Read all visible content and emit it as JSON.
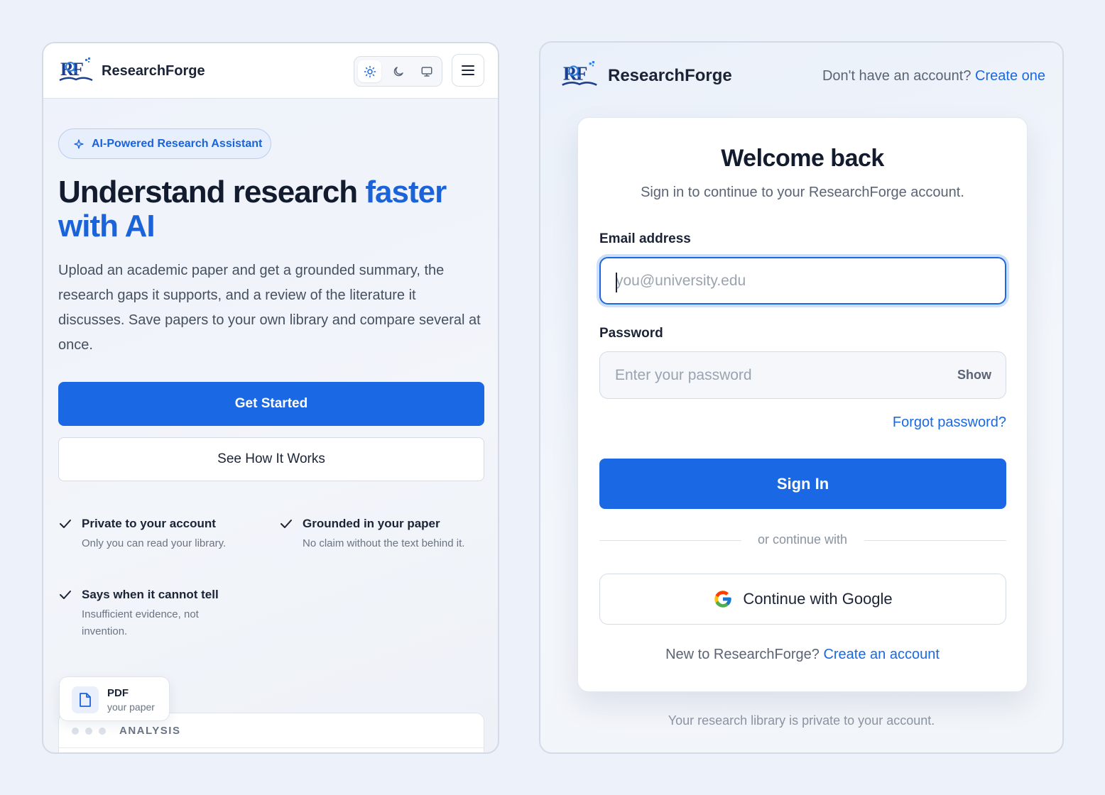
{
  "left_panel": {
    "header": {
      "brand": "ResearchForge",
      "theme_options": [
        "light-icon",
        "dark-icon",
        "system-icon"
      ],
      "active_theme": "light"
    },
    "badge": "AI-Powered Research Assistant",
    "hero": {
      "title_part1": "Understand research ",
      "title_accent": "faster with AI",
      "description": "Upload an academic paper and get a grounded summary, the research gaps it supports, and a review of the literature it discusses. Save papers to your own library and compare several at once."
    },
    "buttons": {
      "primary": "Get Started",
      "secondary": "See How It Works"
    },
    "features": [
      {
        "title": "Private to your account",
        "desc": "Only you can read your library."
      },
      {
        "title": "Grounded in your paper",
        "desc": "No claim without the text behind it."
      },
      {
        "title": "Says when it cannot tell",
        "desc": "Insufficient evidence, not invention."
      }
    ],
    "pdf_card": {
      "title": "PDF",
      "subtitle": "your paper"
    },
    "analysis_card": {
      "label": "ANALYSIS"
    }
  },
  "right_panel": {
    "brand": "ResearchForge",
    "signup_prompt": "Don't have an account?",
    "signup_link": "Create one",
    "card": {
      "title": "Welcome back",
      "subtitle": "Sign in to continue to your ResearchForge account.",
      "email_label": "Email address",
      "email_placeholder": "you@university.edu",
      "password_label": "Password",
      "password_placeholder": "Enter your password",
      "show_label": "Show",
      "forgot_link": "Forgot password?",
      "sign_in": "Sign In",
      "divider": "or continue with",
      "google": "Continue with Google",
      "new_prompt": "New to ResearchForge?",
      "new_link": "Create an account"
    },
    "footer": "Your research library is private to your account."
  },
  "colors": {
    "accent": "#1a68e3",
    "background": "#edf1f9",
    "text_dark": "#131c2e"
  }
}
